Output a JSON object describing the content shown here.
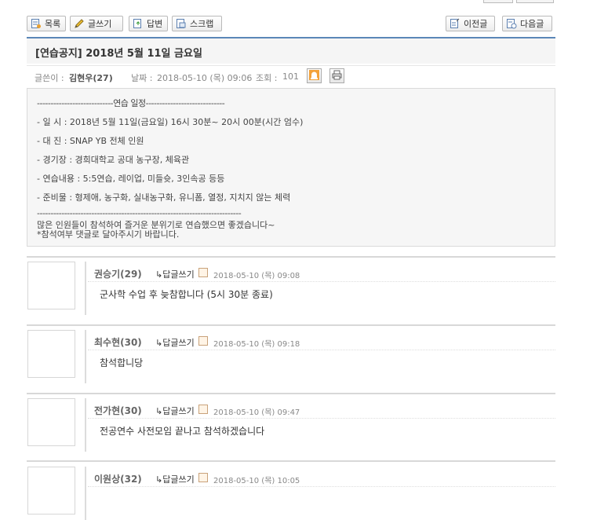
{
  "toolbar": {
    "list_label": "목록",
    "write_label": "글쓰기",
    "reply_label": "답변",
    "scrap_label": "스크랩",
    "prev_label": "이전글",
    "next_label": "다음글"
  },
  "post": {
    "title": "[연습공지] 2018년 5월 11일 금요일",
    "author_prefix": "글쓴이 :",
    "author": "김현우(27)",
    "date_prefix": "날짜 :",
    "date": "2018-05-10 (목) 09:06",
    "views_prefix": "조회 :",
    "views": "101",
    "body": {
      "header_line": "----------------------------연습 일정-----------------------------",
      "lines": [
        "- 일 시 : 2018년 5월 11일(금요일) 16시 30분~ 20시 00분(시간 엄수)",
        "- 대 진 : SNAP YB 전체 인원",
        "- 경기장 : 경희대학교 공대 농구장, 체육관",
        "- 연습내용 : 5:5연습, 레이업, 미들슛, 3인속공 등등",
        "- 준비물 : 형제애, 농구화, 실내농구화, 유니폼, 열정, 지치지 않는 체력"
      ],
      "separator_line": "---------------------------------------------------------------------------",
      "closing_1": "많은 인원들이 참석하여 즐거운 분위기로 연습했으면 좋겠습니다~",
      "closing_2": "*참석여부 댓글로 달아주시기 바랍니다."
    }
  },
  "comments": [
    {
      "name": "권승기(29)",
      "reply_label": "↳답글쓰기",
      "date": "2018-05-10 (목) 09:08",
      "text": "군사학 수업 후 늦참합니다 (5시 30분 종료)"
    },
    {
      "name": "최수현(30)",
      "reply_label": "↳답글쓰기",
      "date": "2018-05-10 (목) 09:18",
      "text": "참석합니당"
    },
    {
      "name": "전가현(30)",
      "reply_label": "↳답글쓰기",
      "date": "2018-05-10 (목) 09:47",
      "text": "전공연수 사전모임 끝나고 참석하겠습니다"
    },
    {
      "name": "이원상(32)",
      "reply_label": "↳답글쓰기",
      "date": "2018-05-10 (목) 10:05",
      "text": ""
    }
  ]
}
